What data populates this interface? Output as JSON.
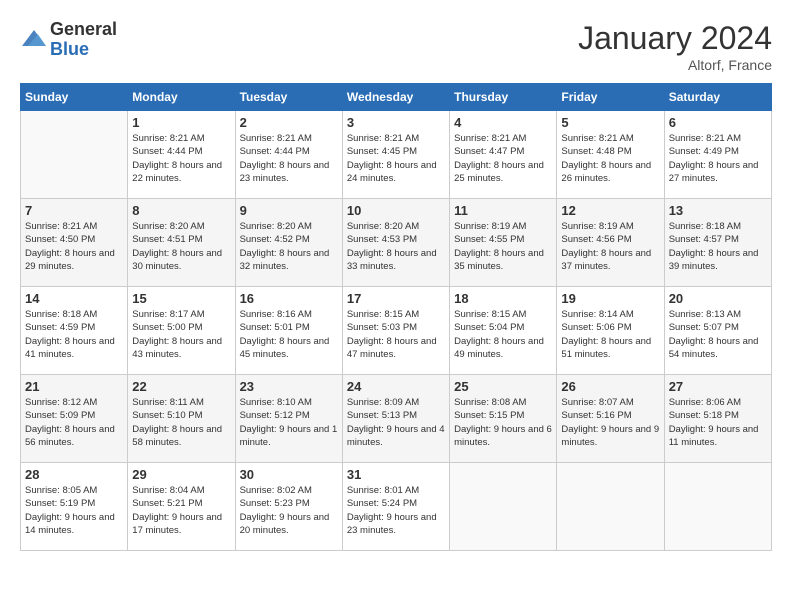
{
  "logo": {
    "general": "General",
    "blue": "Blue"
  },
  "title": "January 2024",
  "location": "Altorf, France",
  "days_header": [
    "Sunday",
    "Monday",
    "Tuesday",
    "Wednesday",
    "Thursday",
    "Friday",
    "Saturday"
  ],
  "weeks": [
    [
      {
        "day": "",
        "sunrise": "",
        "sunset": "",
        "daylight": ""
      },
      {
        "day": "1",
        "sunrise": "8:21 AM",
        "sunset": "4:44 PM",
        "daylight": "8 hours and 22 minutes."
      },
      {
        "day": "2",
        "sunrise": "8:21 AM",
        "sunset": "4:44 PM",
        "daylight": "8 hours and 23 minutes."
      },
      {
        "day": "3",
        "sunrise": "8:21 AM",
        "sunset": "4:45 PM",
        "daylight": "8 hours and 24 minutes."
      },
      {
        "day": "4",
        "sunrise": "8:21 AM",
        "sunset": "4:47 PM",
        "daylight": "8 hours and 25 minutes."
      },
      {
        "day": "5",
        "sunrise": "8:21 AM",
        "sunset": "4:48 PM",
        "daylight": "8 hours and 26 minutes."
      },
      {
        "day": "6",
        "sunrise": "8:21 AM",
        "sunset": "4:49 PM",
        "daylight": "8 hours and 27 minutes."
      }
    ],
    [
      {
        "day": "7",
        "sunrise": "8:21 AM",
        "sunset": "4:50 PM",
        "daylight": "8 hours and 29 minutes."
      },
      {
        "day": "8",
        "sunrise": "8:20 AM",
        "sunset": "4:51 PM",
        "daylight": "8 hours and 30 minutes."
      },
      {
        "day": "9",
        "sunrise": "8:20 AM",
        "sunset": "4:52 PM",
        "daylight": "8 hours and 32 minutes."
      },
      {
        "day": "10",
        "sunrise": "8:20 AM",
        "sunset": "4:53 PM",
        "daylight": "8 hours and 33 minutes."
      },
      {
        "day": "11",
        "sunrise": "8:19 AM",
        "sunset": "4:55 PM",
        "daylight": "8 hours and 35 minutes."
      },
      {
        "day": "12",
        "sunrise": "8:19 AM",
        "sunset": "4:56 PM",
        "daylight": "8 hours and 37 minutes."
      },
      {
        "day": "13",
        "sunrise": "8:18 AM",
        "sunset": "4:57 PM",
        "daylight": "8 hours and 39 minutes."
      }
    ],
    [
      {
        "day": "14",
        "sunrise": "8:18 AM",
        "sunset": "4:59 PM",
        "daylight": "8 hours and 41 minutes."
      },
      {
        "day": "15",
        "sunrise": "8:17 AM",
        "sunset": "5:00 PM",
        "daylight": "8 hours and 43 minutes."
      },
      {
        "day": "16",
        "sunrise": "8:16 AM",
        "sunset": "5:01 PM",
        "daylight": "8 hours and 45 minutes."
      },
      {
        "day": "17",
        "sunrise": "8:15 AM",
        "sunset": "5:03 PM",
        "daylight": "8 hours and 47 minutes."
      },
      {
        "day": "18",
        "sunrise": "8:15 AM",
        "sunset": "5:04 PM",
        "daylight": "8 hours and 49 minutes."
      },
      {
        "day": "19",
        "sunrise": "8:14 AM",
        "sunset": "5:06 PM",
        "daylight": "8 hours and 51 minutes."
      },
      {
        "day": "20",
        "sunrise": "8:13 AM",
        "sunset": "5:07 PM",
        "daylight": "8 hours and 54 minutes."
      }
    ],
    [
      {
        "day": "21",
        "sunrise": "8:12 AM",
        "sunset": "5:09 PM",
        "daylight": "8 hours and 56 minutes."
      },
      {
        "day": "22",
        "sunrise": "8:11 AM",
        "sunset": "5:10 PM",
        "daylight": "8 hours and 58 minutes."
      },
      {
        "day": "23",
        "sunrise": "8:10 AM",
        "sunset": "5:12 PM",
        "daylight": "9 hours and 1 minute."
      },
      {
        "day": "24",
        "sunrise": "8:09 AM",
        "sunset": "5:13 PM",
        "daylight": "9 hours and 4 minutes."
      },
      {
        "day": "25",
        "sunrise": "8:08 AM",
        "sunset": "5:15 PM",
        "daylight": "9 hours and 6 minutes."
      },
      {
        "day": "26",
        "sunrise": "8:07 AM",
        "sunset": "5:16 PM",
        "daylight": "9 hours and 9 minutes."
      },
      {
        "day": "27",
        "sunrise": "8:06 AM",
        "sunset": "5:18 PM",
        "daylight": "9 hours and 11 minutes."
      }
    ],
    [
      {
        "day": "28",
        "sunrise": "8:05 AM",
        "sunset": "5:19 PM",
        "daylight": "9 hours and 14 minutes."
      },
      {
        "day": "29",
        "sunrise": "8:04 AM",
        "sunset": "5:21 PM",
        "daylight": "9 hours and 17 minutes."
      },
      {
        "day": "30",
        "sunrise": "8:02 AM",
        "sunset": "5:23 PM",
        "daylight": "9 hours and 20 minutes."
      },
      {
        "day": "31",
        "sunrise": "8:01 AM",
        "sunset": "5:24 PM",
        "daylight": "9 hours and 23 minutes."
      },
      {
        "day": "",
        "sunrise": "",
        "sunset": "",
        "daylight": ""
      },
      {
        "day": "",
        "sunrise": "",
        "sunset": "",
        "daylight": ""
      },
      {
        "day": "",
        "sunrise": "",
        "sunset": "",
        "daylight": ""
      }
    ]
  ],
  "labels": {
    "sunrise": "Sunrise:",
    "sunset": "Sunset:",
    "daylight": "Daylight:"
  }
}
